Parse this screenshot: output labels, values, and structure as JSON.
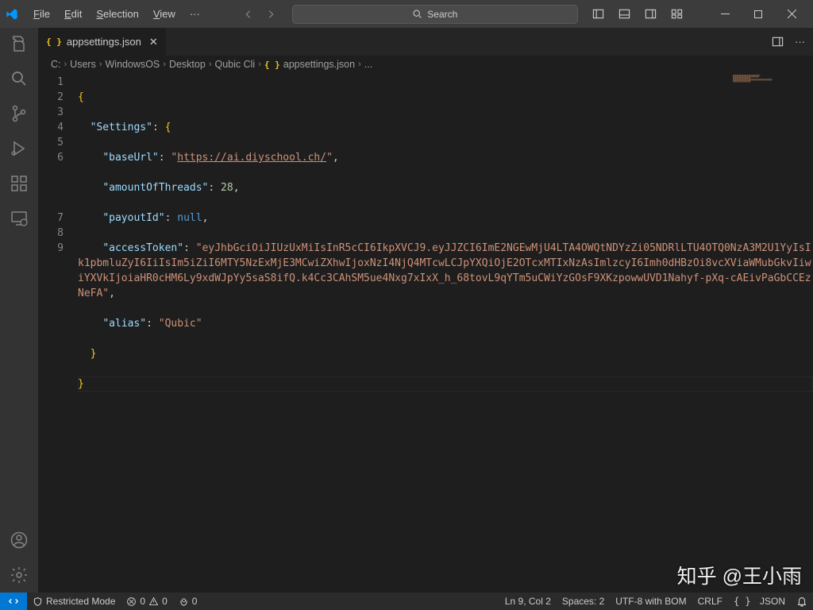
{
  "menu": {
    "file": "File",
    "edit": "Edit",
    "selection": "Selection",
    "view": "View",
    "more": "···"
  },
  "search": {
    "placeholder": "Search"
  },
  "tab": {
    "title": "appsettings.json"
  },
  "breadcrumb": [
    "C:",
    "Users",
    "WindowsOS",
    "Desktop",
    "Qubic Cli",
    "appsettings.json",
    "..."
  ],
  "code": {
    "lines": [
      "1",
      "2",
      "3",
      "4",
      "5",
      "6",
      "7",
      "8",
      "9"
    ],
    "l1": "{",
    "l2_indent": "  ",
    "l2_key": "\"Settings\"",
    "l2_colon": ": ",
    "l2_brace": "{",
    "l3_indent": "    ",
    "l3_key": "\"baseUrl\"",
    "l3_colon": ": ",
    "l3_str_q1": "\"",
    "l3_url": "https://ai.diyschool.ch/",
    "l3_str_q2": "\"",
    "l3_comma": ",",
    "l4_indent": "    ",
    "l4_key": "\"amountOfThreads\"",
    "l4_colon": ": ",
    "l4_num": "28",
    "l4_comma": ",",
    "l5_indent": "    ",
    "l5_key": "\"payoutId\"",
    "l5_colon": ": ",
    "l5_null": "null",
    "l5_comma": ",",
    "l6_indent": "    ",
    "l6_key": "\"accessToken\"",
    "l6_colon": ": ",
    "l6_str": "\"eyJhbGciOiJIUzUxMiIsInR5cCI6IkpXVCJ9.eyJJZCI6ImE2NGEwMjU4LTA4OWQtNDYzZi05NDRlLTU4OTQ0NzA3M2U1YyIsIk1pbmluZyI6IiIsIm5iZiI6MTY5NzExMjE3MCwiZXhwIjoxNzI4NjQ4MTcwLCJpYXQiOjE2OTcxMTIxNzAsImlzcyI6Imh0dHBzOi8vcXViaWMubGkvIiwiYXVkIjoiaHR0cHM6Ly9xdWJpYy5saS8ifQ.k4Cc3CAhSM5ue4Nxg7xIxX_h_68tovL9qYTm5uCWiYzGOsF9XKzpowwUVD1Nahyf-pXq-cAEivPaGbCCEzNeFA\"",
    "l6_comma": ",",
    "l7_indent": "    ",
    "l7_key": "\"alias\"",
    "l7_colon": ": ",
    "l7_str": "\"Qubic\"",
    "l8_indent": "  ",
    "l8_brace": "}",
    "l9": "}"
  },
  "status": {
    "restricted": "Restricted Mode",
    "err": "0",
    "warn": "0",
    "port": "0",
    "lncol": "Ln 9, Col 2",
    "spaces": "Spaces: 2",
    "enc": "UTF-8 with BOM",
    "eol": "CRLF",
    "lang": "JSON"
  },
  "watermark": "知乎 @王小雨"
}
